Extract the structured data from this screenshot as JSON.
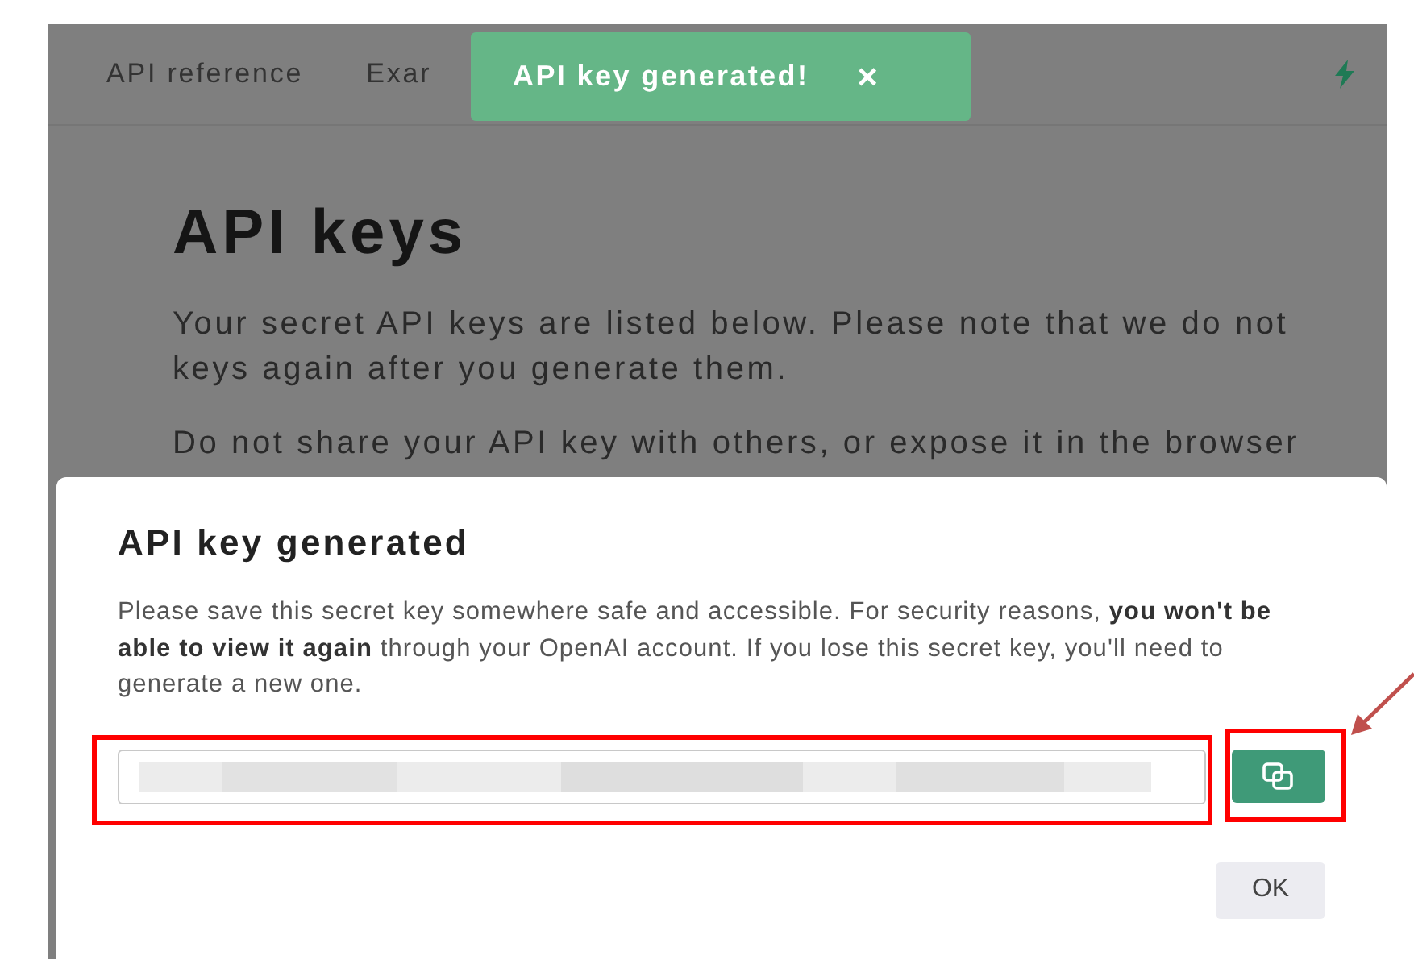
{
  "nav": {
    "items": [
      "API reference",
      "Exar"
    ]
  },
  "page": {
    "title": "API keys",
    "paragraphs": [
      "Your secret API keys are listed below. Please note that we do not\nkeys again after you generate them.",
      "Do not share your API key with others, or expose it in the browser"
    ]
  },
  "toast": {
    "message": "API key generated!",
    "close": "×"
  },
  "modal": {
    "title": "API key generated",
    "body": "Please save this secret key somewhere safe and accessible. For security reasons, **you won't be able to view it again** through your OpenAI account. If you lose this secret key, you'll need to generate a new one.",
    "ok_button": "OK"
  },
  "annotations": [
    {
      "kind": "field_box"
    },
    {
      "kind": "button_box"
    },
    {
      "kind": "arrow"
    }
  ]
}
